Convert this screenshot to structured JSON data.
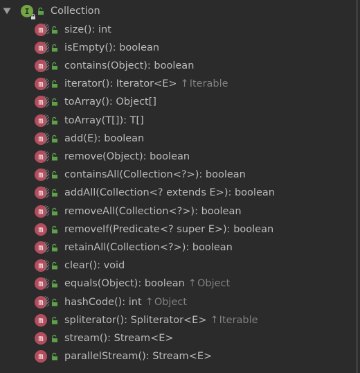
{
  "root": {
    "label": "Collection",
    "kind_icon": "interface-icon",
    "kind_letter": "I",
    "visibility_icon": "public-unlock-icon",
    "expanded": true
  },
  "members": [
    {
      "signature": "size(): int",
      "origin": null,
      "abstract": true
    },
    {
      "signature": "isEmpty(): boolean",
      "origin": null,
      "abstract": true
    },
    {
      "signature": "contains(Object): boolean",
      "origin": null,
      "abstract": true
    },
    {
      "signature": "iterator(): Iterator<E>",
      "origin": "Iterable",
      "abstract": true
    },
    {
      "signature": "toArray(): Object[]",
      "origin": null,
      "abstract": true
    },
    {
      "signature": "toArray(T[]): T[]",
      "origin": null,
      "abstract": true
    },
    {
      "signature": "add(E): boolean",
      "origin": null,
      "abstract": true
    },
    {
      "signature": "remove(Object): boolean",
      "origin": null,
      "abstract": true
    },
    {
      "signature": "containsAll(Collection<?>): boolean",
      "origin": null,
      "abstract": true
    },
    {
      "signature": "addAll(Collection<? extends E>): boolean",
      "origin": null,
      "abstract": true
    },
    {
      "signature": "removeAll(Collection<?>): boolean",
      "origin": null,
      "abstract": true
    },
    {
      "signature": "removeIf(Predicate<? super E>): boolean",
      "origin": null,
      "abstract": false
    },
    {
      "signature": "retainAll(Collection<?>): boolean",
      "origin": null,
      "abstract": true
    },
    {
      "signature": "clear(): void",
      "origin": null,
      "abstract": true
    },
    {
      "signature": "equals(Object): boolean",
      "origin": "Object",
      "abstract": true
    },
    {
      "signature": "hashCode(): int",
      "origin": "Object",
      "abstract": true
    },
    {
      "signature": "spliterator(): Spliterator<E>",
      "origin": "Iterable",
      "abstract": false
    },
    {
      "signature": "stream(): Stream<E>",
      "origin": null,
      "abstract": false
    },
    {
      "signature": "parallelStream(): Stream<E>",
      "origin": null,
      "abstract": false
    }
  ],
  "method_letter": "m",
  "origin_arrow": "↑",
  "colors": {
    "background": "#2b2b2b",
    "text": "#bbbbbb",
    "inherited_text": "#808080",
    "interface_badge": "#75a446",
    "method_badge": "#b34e5e",
    "public_lock": "#5ea14a"
  }
}
